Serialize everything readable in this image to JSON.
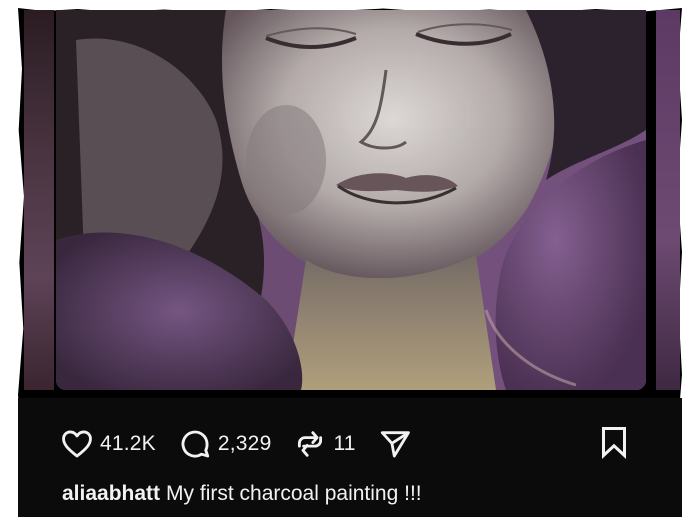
{
  "post": {
    "image_icon": "charcoal-painting-face",
    "likes": "41.2K",
    "comments": "2,329",
    "reposts": "11",
    "username": "aliaabhatt",
    "caption": "My first charcoal painting !!!"
  },
  "icons": {
    "like": "heart-icon",
    "comment": "comment-icon",
    "repost": "repost-icon",
    "share": "send-icon",
    "save": "bookmark-icon"
  },
  "colors": {
    "background": "#0b0b0b",
    "text": "#f2f2f2",
    "painting_purple": "#6e4a73"
  }
}
